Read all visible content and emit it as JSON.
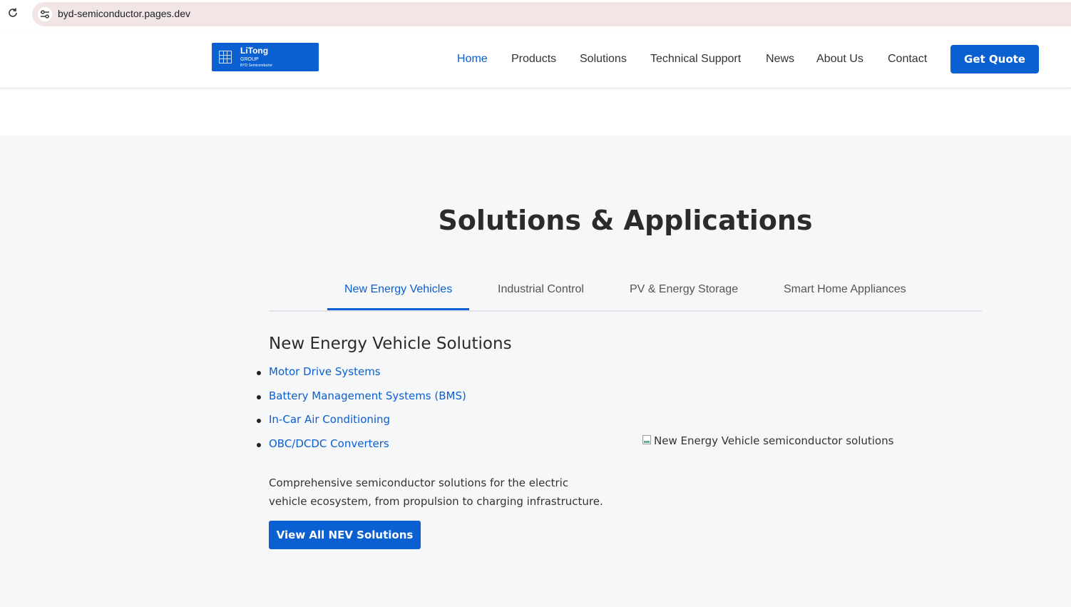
{
  "browser": {
    "url": "byd-semiconductor.pages.dev",
    "icons": {
      "reload": "reload-icon",
      "site_info": "site-info-icon"
    }
  },
  "header": {
    "logo": {
      "name": "LiTong",
      "group": "GROUP",
      "sub": "BYD Semiconductor"
    },
    "nav": [
      "Home",
      "Products",
      "Solutions",
      "Technical Support",
      "News",
      "About Us",
      "Contact"
    ],
    "active_nav": "Home",
    "cta": "Get Quote"
  },
  "section": {
    "title": "Solutions & Applications",
    "tabs": [
      "New Energy Vehicles",
      "Industrial Control",
      "PV & Energy Storage",
      "Smart Home Appliances"
    ],
    "active_tab": "New Energy Vehicles",
    "panel": {
      "title": "New Energy Vehicle Solutions",
      "items": [
        "Motor Drive Systems",
        "Battery Management Systems (BMS)",
        "In-Car Air Conditioning",
        "OBC/DCDC Converters"
      ],
      "description": "Comprehensive semiconductor solutions for the electric vehicle ecosystem, from propulsion to charging infrastructure.",
      "button": "View All NEV Solutions",
      "image_alt": "New Energy Vehicle semiconductor solutions"
    }
  },
  "colors": {
    "accent": "#0a5fd1",
    "section_bg": "#f6f7f9",
    "url_bar": "#f1e5e5"
  }
}
